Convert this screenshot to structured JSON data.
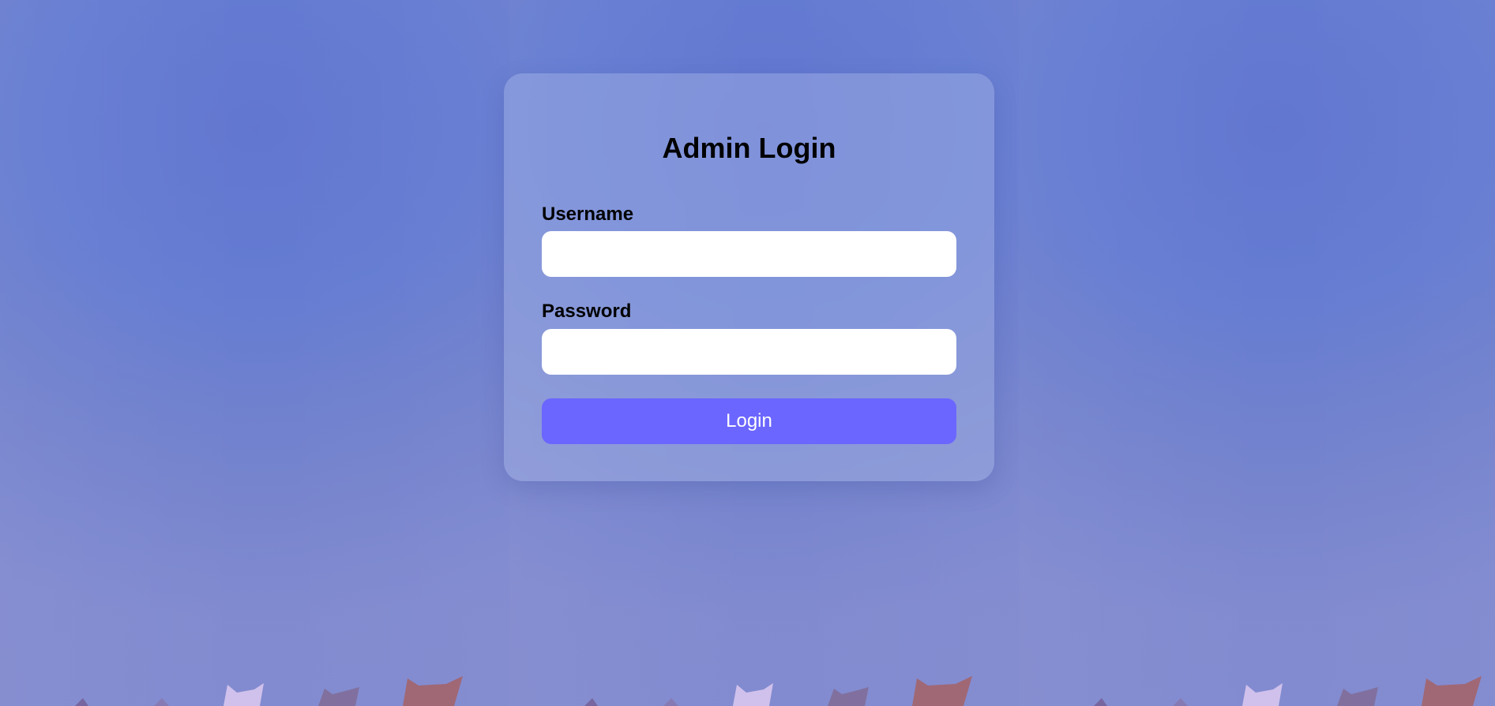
{
  "page": {
    "title": "Admin Login"
  },
  "form": {
    "username_label": "Username",
    "username_value": "",
    "username_placeholder": "",
    "password_label": "Password",
    "password_value": "",
    "password_placeholder": "",
    "submit_label": "Login"
  },
  "theme": {
    "background": "#6a7fd2",
    "card_background": "#aab8e6",
    "button_color": "#6b66ff",
    "text_color": "#000000",
    "button_text_color": "#ffffff"
  }
}
